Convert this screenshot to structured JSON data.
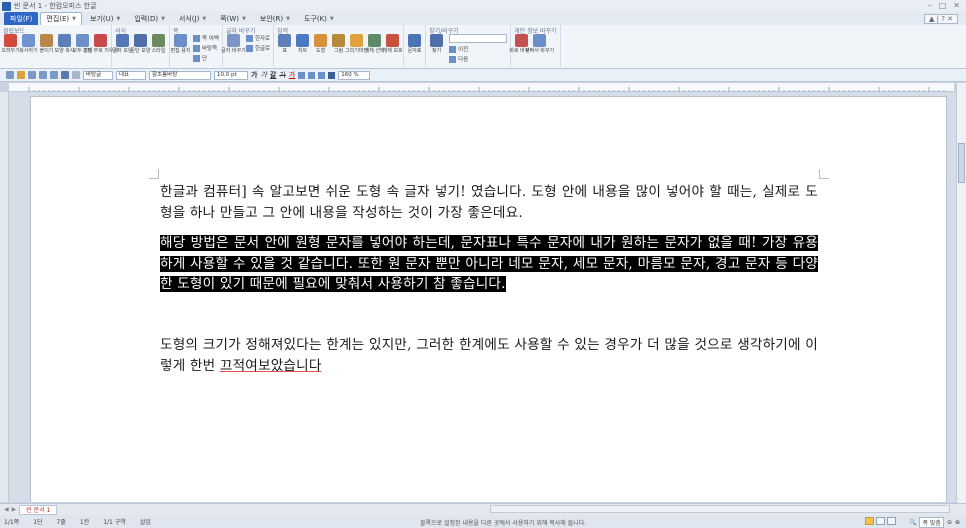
{
  "window": {
    "title": "빈 문서 1 - 한컴오피스 한글",
    "controls": [
      "–",
      "□",
      "✕"
    ]
  },
  "menu": {
    "file": "파일(F)",
    "items": [
      {
        "label": "편집(E)",
        "active": true
      },
      {
        "label": "보기(U)",
        "active": false
      },
      {
        "label": "입력(D)",
        "active": false
      },
      {
        "label": "서식(J)",
        "active": false
      },
      {
        "label": "쪽(W)",
        "active": false
      },
      {
        "label": "보안(R)",
        "active": false
      },
      {
        "label": "도구(K)",
        "active": false
      }
    ],
    "right": "▲ | ? ✕"
  },
  "ribbon": {
    "groups": [
      {
        "label": "클립보드",
        "buttons": [
          {
            "label": "오려두기",
            "icon": "scissors-icon",
            "color": "#d24a3c"
          },
          {
            "label": "복사하기",
            "icon": "copy-icon",
            "color": "#6f93cf"
          },
          {
            "label": "붙이기",
            "icon": "paste-icon",
            "color": "#b7884a"
          },
          {
            "label": "모양 복사",
            "icon": "format-copy-icon",
            "color": "#5f7fb8"
          },
          {
            "label": "모두 선택",
            "icon": "select-all-icon",
            "color": "#6b8fc9"
          },
          {
            "label": "조판 부호 지우기",
            "icon": "clear-marks-icon",
            "color": "#c84a4a"
          }
        ]
      },
      {
        "label": "서식",
        "buttons": [
          {
            "label": "글자 모양",
            "icon": "char-shape-icon",
            "color": "#5577b5"
          },
          {
            "label": "문단 모양",
            "icon": "para-shape-icon",
            "color": "#4f6fa8"
          },
          {
            "label": "스타일",
            "icon": "style-icon",
            "color": "#6c8a5f"
          }
        ]
      },
      {
        "label": "쪽",
        "buttons": [
          {
            "label": "편집 용지",
            "icon": "page-setup-icon",
            "color": "#6b8fc9"
          }
        ],
        "small": [
          "쪽 여백",
          "바탕쪽",
          "단"
        ]
      },
      {
        "label": "글자 바꾸기",
        "buttons": [
          {
            "label": "글자 바꾸기",
            "icon": "char-replace-icon",
            "color": "#7a95c6"
          }
        ],
        "small": [
          "한자로",
          "한글로"
        ]
      },
      {
        "label": "입력",
        "buttons": [
          {
            "label": "표",
            "icon": "table-icon",
            "color": "#5f7fb8"
          },
          {
            "label": "차트",
            "icon": "chart-icon",
            "color": "#4c79c2"
          },
          {
            "label": "도형",
            "icon": "shape-icon",
            "color": "#d6913a"
          },
          {
            "label": "그림",
            "icon": "picture-icon",
            "color": "#b78a3a"
          },
          {
            "label": "그리기마당",
            "icon": "drawing-icon",
            "color": "#e0a33a"
          },
          {
            "label": "개체 선택",
            "icon": "object-select-icon",
            "color": "#5f8a6a"
          },
          {
            "label": "개체 보호",
            "icon": "object-protect-icon",
            "color": "#c7523f"
          }
        ]
      },
      {
        "label": "",
        "buttons": [
          {
            "label": "문자표",
            "icon": "symbol-icon",
            "color": "#4b74b4"
          }
        ]
      },
      {
        "label": "찾기/바꾸기",
        "buttons": [
          {
            "label": "찾기",
            "icon": "binoculars-icon",
            "color": "#4f6fa8"
          }
        ],
        "small": [
          "이전",
          "다음"
        ]
      },
      {
        "label": "개인 정보 바꾸기",
        "buttons": [
          {
            "label": "바로 바꾸기",
            "icon": "quick-replace-icon",
            "color": "#c55050"
          },
          {
            "label": "찾아서 바꾸기",
            "icon": "find-replace-icon",
            "color": "#6b8fc9"
          }
        ]
      }
    ]
  },
  "toolbar2": {
    "style": "바탕글",
    "lang": "대표",
    "font": "함초롬바탕",
    "size": "10.0",
    "size_unit": "pt",
    "bold": "가",
    "italic": "가",
    "underline": "갈",
    "strike": "가",
    "color_a": "가",
    "line_spacing": "160",
    "line_spacing_unit": "%"
  },
  "document": {
    "para1": "한글과 컴퓨터] 속 알고보면 쉬운 도형 속 글자 넣기! 였습니다. 도형 안에 내용을 많이 넣어야 할 때는, 실제로 도형을 하나 만들고 그 안에 내용을 작성하는 것이 가장 좋은데요.",
    "para2_selected": "해당 방법은 문서 안에 원형  문자를 넣어야 하는데, 문자표나 특수 문자에 내가 원하는 문자가 없을 때! 가장 유용하게 사용할 수 있을 것 같습니다. 또한 원 문자 뿐만 아니라 네모 문자, 세모 문자, 마름모 문자, 경고 문자 등 다양한 도형이 있기 때문에 필요에 맞춰서 사용하기 참 좋습니다.",
    "para3_a": "도형의 크기가 정해져있다는 한계는 있지만, 그러한 한계에도 사용할 수 있는 경우가 더 많을 것으로 생각하기에 이렇게 한번 ",
    "para3_b": "끄적여보았습니다"
  },
  "tabs": {
    "doc_tab": "빈 문서 1"
  },
  "status": {
    "page": "1/1쪽",
    "section": "1단",
    "line": "7줄",
    "col": "1칸",
    "sect": "1/1 구역",
    "mode": "삽입",
    "message": "블록으로 설정된 내용을 다른 곳에서 사용하기 위해 복사해 둡니다.",
    "zoom": "폭 맞춤"
  }
}
